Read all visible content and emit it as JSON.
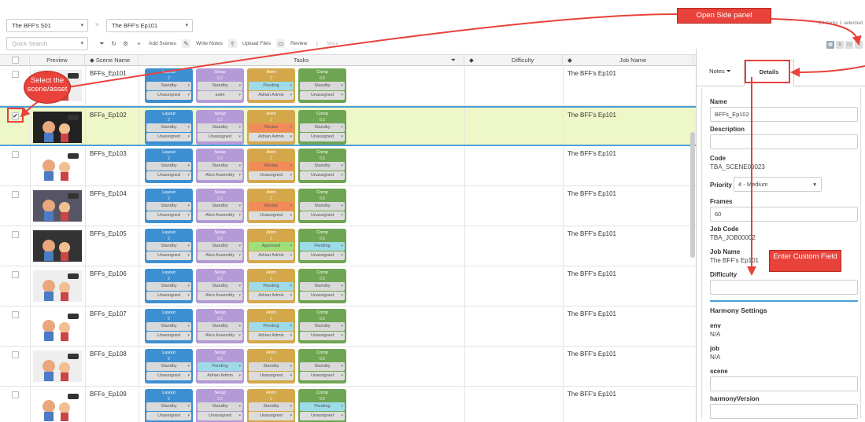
{
  "header": {
    "season": "The BFF's S01",
    "episode": "The BFF's Ep101",
    "crumb_sep": ">",
    "quick_search_placeholder": "Quick Search",
    "toolbar": {
      "filter_icon": "filter-icon",
      "refresh_icon": "refresh-icon",
      "settings_icon": "gear-icon",
      "add_scenes": "Add Scenes",
      "write_notes": "Write Notes",
      "upload_files": "Upload Files",
      "review": "Review",
      "more": "More"
    },
    "item_count": "20 items",
    "selected_count": "1 selected"
  },
  "columns": {
    "preview": "Preview",
    "scene_name": "Scene Name",
    "tasks": "Tasks",
    "difficulty": "Difficulty",
    "job_name": "Job Name"
  },
  "task_names": {
    "layout": "Layout",
    "setup": "Setup",
    "anim": "Anim",
    "comp": "Comp"
  },
  "task_colors": {
    "layout": "#3d8fd1",
    "setup": "#b49ad6",
    "anim": "#d4a84a",
    "comp": "#6ea553"
  },
  "rows": [
    {
      "name": "BFFs_Ep101",
      "checked": "",
      "job": "The BFF's Ep101",
      "l_num": "2",
      "s_num": "0.2",
      "a_num": "2",
      "c_num": "0.5",
      "status": [
        "Standby",
        "Standby",
        "Pending",
        "Standby"
      ],
      "status_colors": [
        "#d9d9d9",
        "#d9d9d9",
        "#9ddbe8",
        "#d9d9d9"
      ],
      "assign": [
        "Unassigned",
        "anim",
        "Adrian Admin",
        "Unassigned"
      ]
    },
    {
      "name": "BFFs_Ep102",
      "checked": "✔",
      "job": "The BFF's Ep101",
      "l_num": "2",
      "s_num": "0.2",
      "a_num": "2",
      "c_num": "0.5",
      "status": [
        "Standby",
        "Standby",
        "Revise",
        "Standby"
      ],
      "status_colors": [
        "#d9d9d9",
        "#d9d9d9",
        "#f28a5a",
        "#d9d9d9"
      ],
      "assign": [
        "Unassigned",
        "Unassigned",
        "Adrian Admin",
        "Unassigned"
      ]
    },
    {
      "name": "BFFs_Ep103",
      "checked": "",
      "job": "The BFF's Ep101",
      "l_num": "2",
      "s_num": "0.2",
      "a_num": "2",
      "c_num": "0.5",
      "status": [
        "Standby",
        "Standby",
        "Revise",
        "Standby"
      ],
      "status_colors": [
        "#d9d9d9",
        "#d9d9d9",
        "#f28a5a",
        "#d9d9d9"
      ],
      "assign": [
        "Unassigned",
        "Alice Assembly",
        "Unassigned",
        "Unassigned"
      ]
    },
    {
      "name": "BFFs_Ep104",
      "checked": "",
      "job": "The BFF's Ep101",
      "l_num": "2",
      "s_num": "0.2",
      "a_num": "2",
      "c_num": "0.5",
      "status": [
        "Standby",
        "Standby",
        "Revise",
        "Standby"
      ],
      "status_colors": [
        "#d9d9d9",
        "#d9d9d9",
        "#f28a5a",
        "#d9d9d9"
      ],
      "assign": [
        "Unassigned",
        "Alice Assembly",
        "Unassigned",
        "Unassigned"
      ]
    },
    {
      "name": "BFFs_Ep105",
      "checked": "",
      "job": "The BFF's Ep101",
      "l_num": "2",
      "s_num": "0.2",
      "a_num": "2",
      "c_num": "0.5",
      "status": [
        "Standby",
        "Standby",
        "Approved",
        "Pending"
      ],
      "status_colors": [
        "#d9d9d9",
        "#d9d9d9",
        "#9de07a",
        "#9ddbe8"
      ],
      "assign": [
        "Unassigned",
        "Alice Assembly",
        "Adrian Admin",
        "Unassigned"
      ]
    },
    {
      "name": "BFFs_Ep106",
      "checked": "",
      "job": "The BFF's Ep101",
      "l_num": "2",
      "s_num": "0.2",
      "a_num": "2",
      "c_num": "0.5",
      "status": [
        "Standby",
        "Standby",
        "Pending",
        "Standby"
      ],
      "status_colors": [
        "#d9d9d9",
        "#d9d9d9",
        "#9ddbe8",
        "#d9d9d9"
      ],
      "assign": [
        "Unassigned",
        "Alice Assembly",
        "Adrian Admin",
        "Unassigned"
      ]
    },
    {
      "name": "BFFs_Ep107",
      "checked": "",
      "job": "The BFF's Ep101",
      "l_num": "2",
      "s_num": "0.2",
      "a_num": "2",
      "c_num": "0.5",
      "status": [
        "Standby",
        "Standby",
        "Pending",
        "Standby"
      ],
      "status_colors": [
        "#d9d9d9",
        "#d9d9d9",
        "#9ddbe8",
        "#d9d9d9"
      ],
      "assign": [
        "Unassigned",
        "Alice Assembly",
        "Adrian Admin",
        "Unassigned"
      ]
    },
    {
      "name": "BFFs_Ep108",
      "checked": "",
      "job": "The BFF's Ep101",
      "l_num": "2",
      "s_num": "0.2",
      "a_num": "2",
      "c_num": "0.5",
      "status": [
        "Standby",
        "Pending",
        "Standby",
        "Standby"
      ],
      "status_colors": [
        "#d9d9d9",
        "#9ddbe8",
        "#d9d9d9",
        "#d9d9d9"
      ],
      "assign": [
        "Unassigned",
        "Adrian Admin",
        "Unassigned",
        "Unassigned"
      ]
    },
    {
      "name": "BFFs_Ep109",
      "checked": "",
      "job": "The BFF's Ep101",
      "l_num": "2",
      "s_num": "0.2",
      "a_num": "2",
      "c_num": "0.5",
      "status": [
        "Standby",
        "Standby",
        "Standby",
        "Pending"
      ],
      "status_colors": [
        "#d9d9d9",
        "#d9d9d9",
        "#d9d9d9",
        "#9ddbe8"
      ],
      "assign": [
        "Unassigned",
        "Unassigned",
        "Unassigned",
        "Unassigned"
      ]
    }
  ],
  "side_panel": {
    "tab_notes": "Notes",
    "tab_details": "Details",
    "name_label": "Name",
    "name_value": "BFFs_Ep102",
    "description_label": "Description",
    "description_value": "",
    "code_label": "Code",
    "code_value": "TBA_SCENE00023",
    "priority_label": "Priority",
    "priority_value": "4 - Medium",
    "frames_label": "Frames",
    "frames_value": "60",
    "job_code_label": "Job Code",
    "job_code_value": "TBA_JOB00002",
    "job_name_label": "Job Name",
    "job_name_value": "The BFF's Ep101",
    "difficulty_label": "Difficulty",
    "difficulty_value": "",
    "harmony_header": "Harmony Settings",
    "env_label": "env",
    "env_value": "N/A",
    "job_label": "job",
    "job_value": "N/A",
    "scene_label": "scene",
    "scene_value": "",
    "harmony_version_label": "harmonyVersion",
    "harmony_version_value": ""
  },
  "annotations": {
    "open_side_panel": "Open Side panel",
    "select_scene": "Select the scene/asset",
    "enter_custom_field": "Enter Custom Field",
    "color": "#e8423a"
  }
}
